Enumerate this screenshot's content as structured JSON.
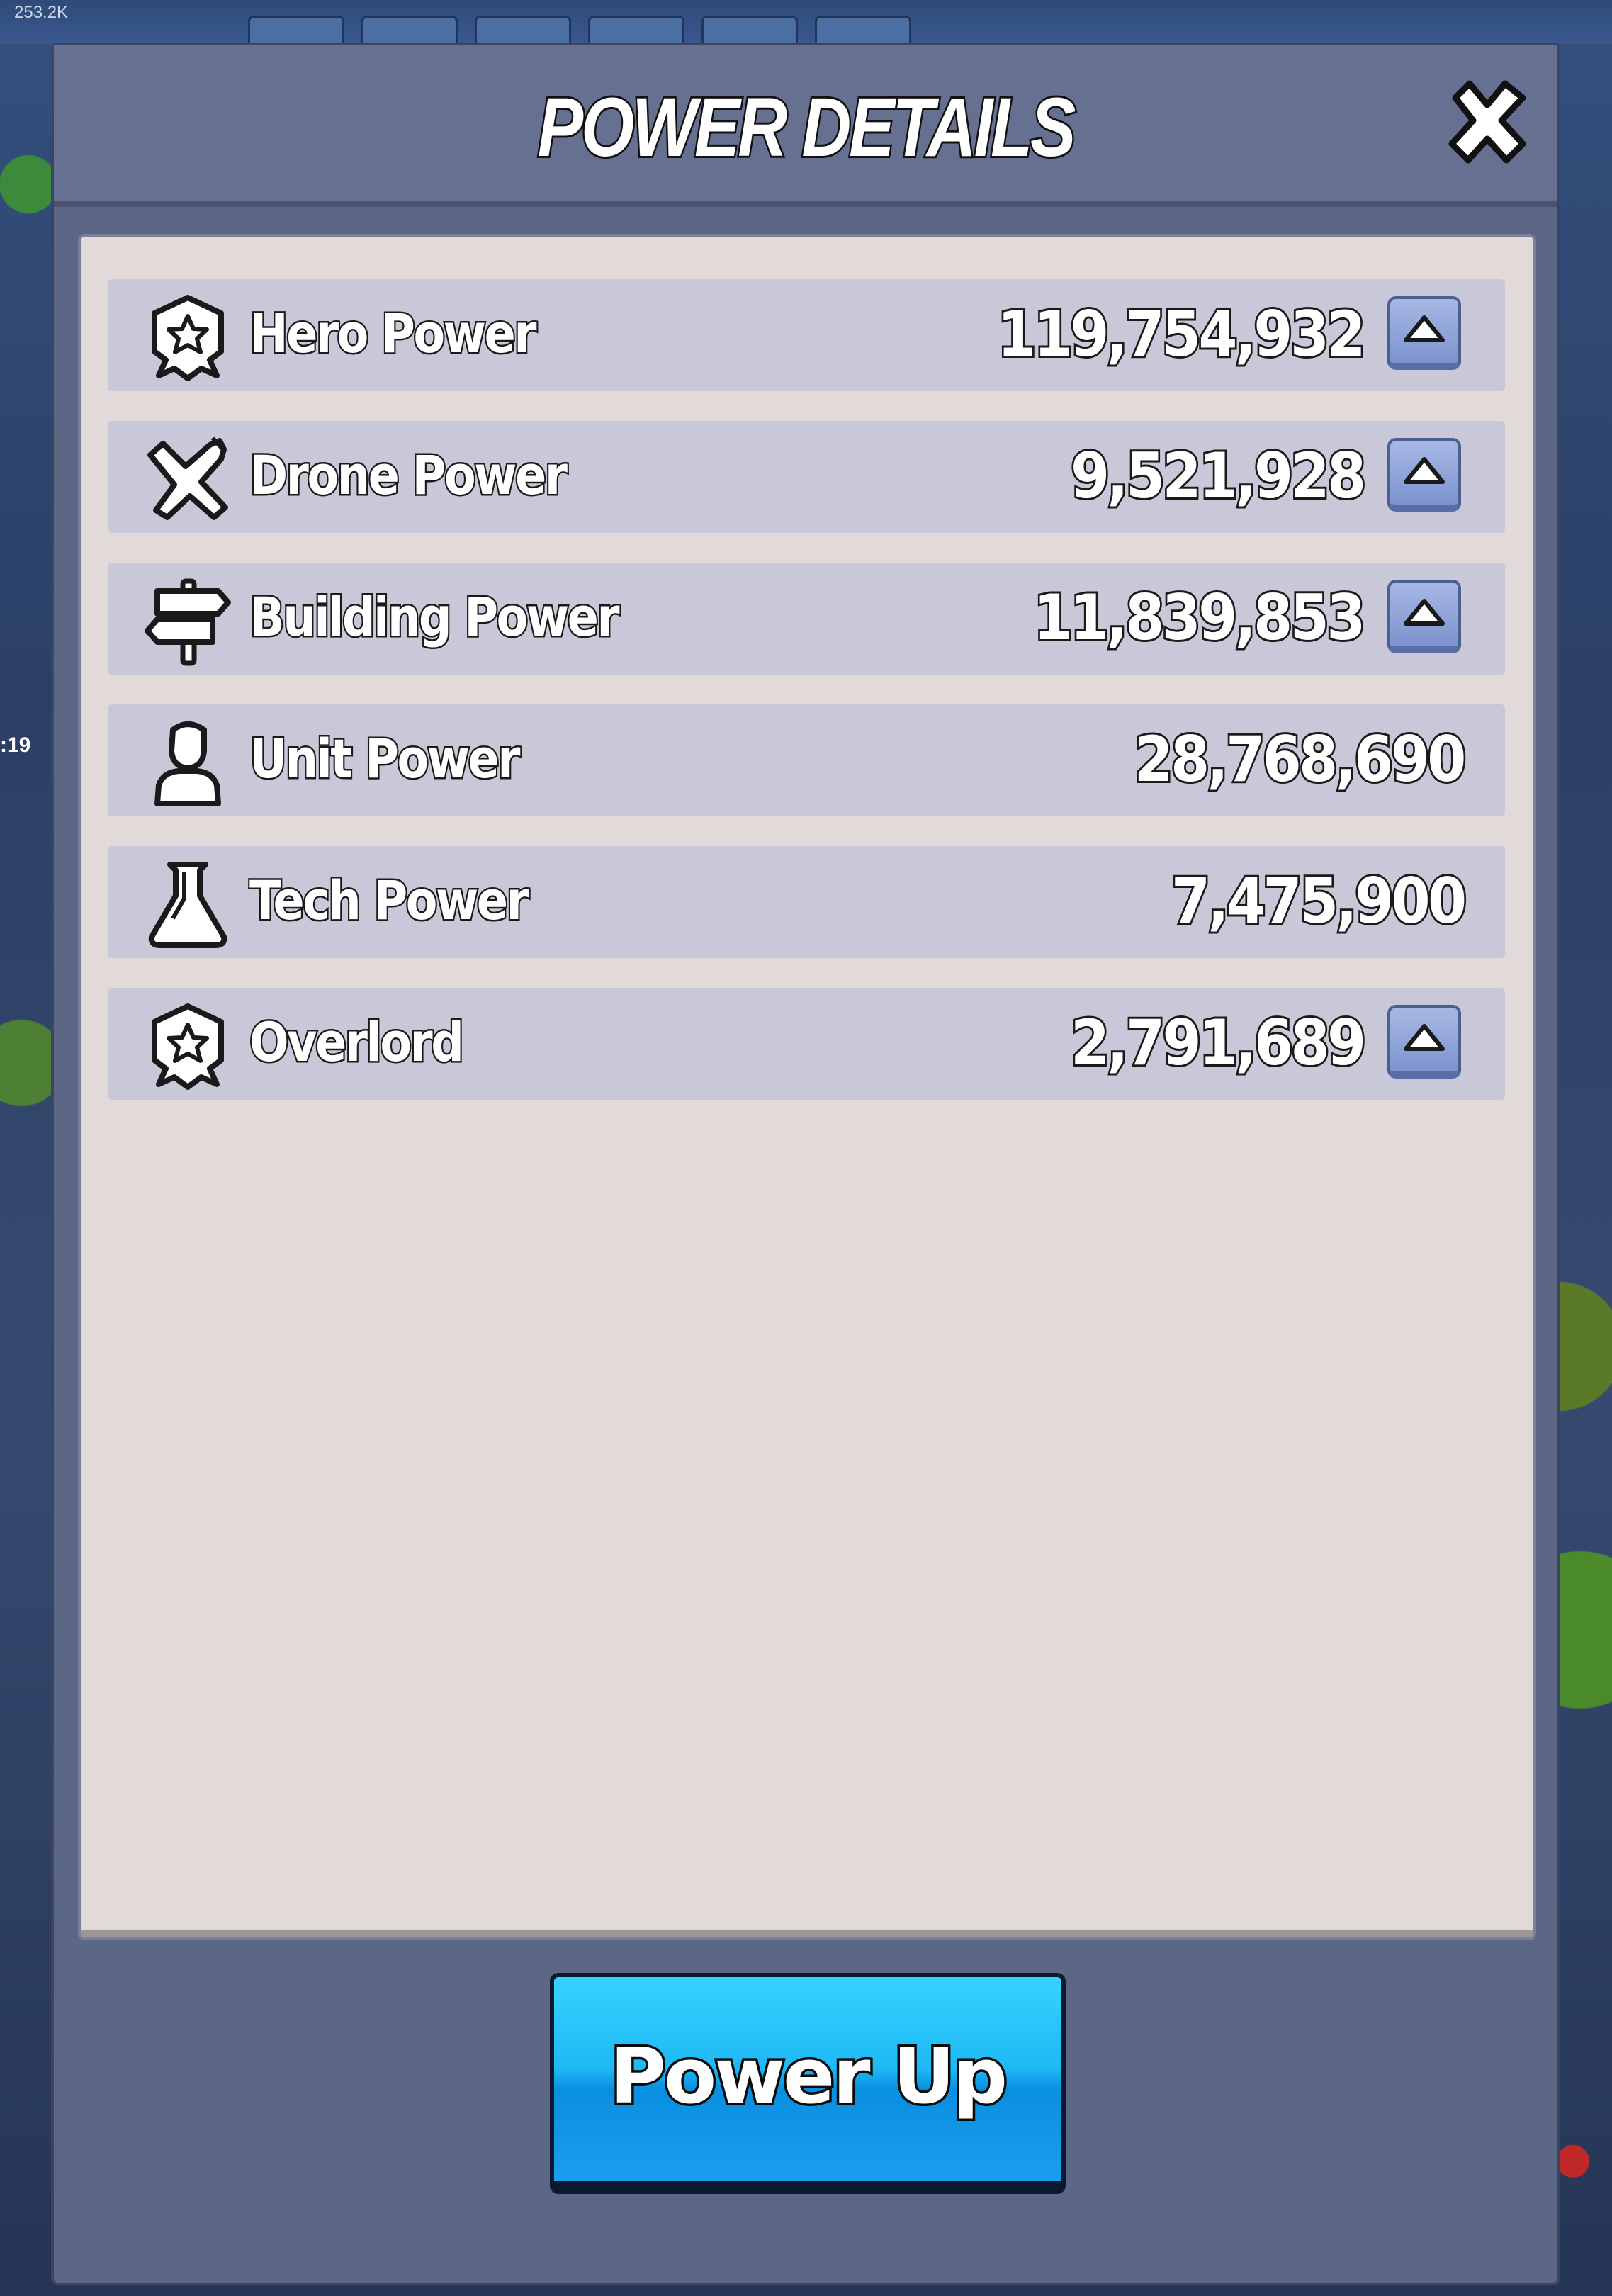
{
  "background": {
    "corner_label": "253.2K",
    "side_text": ":19"
  },
  "modal": {
    "title": "POWER DETAILS",
    "close_icon": "close-x-icon"
  },
  "rows": [
    {
      "label": "Hero Power",
      "value": "119,754,932",
      "icon": "hero-badge-icon",
      "has_upgrade": true
    },
    {
      "label": "Drone Power",
      "value": "9,521,928",
      "icon": "drone-plane-icon",
      "has_upgrade": true
    },
    {
      "label": "Building Power",
      "value": "11,839,853",
      "icon": "signpost-icon",
      "has_upgrade": true
    },
    {
      "label": "Unit Power",
      "value": "28,768,690",
      "icon": "soldier-bust-icon",
      "has_upgrade": false
    },
    {
      "label": "Tech Power",
      "value": "7,475,900",
      "icon": "flask-icon",
      "has_upgrade": false
    },
    {
      "label": "Overlord",
      "value": "2,791,689",
      "icon": "overlord-badge-icon",
      "has_upgrade": true
    }
  ],
  "footer": {
    "power_up_label": "Power Up"
  },
  "colors": {
    "modal_bg": "#5c6685",
    "panel_bg": "#e2dad8",
    "row_bg": "#c9c8d8",
    "button_blue": "#1eb8f4",
    "upgrade_button": "#8fa3d9"
  }
}
